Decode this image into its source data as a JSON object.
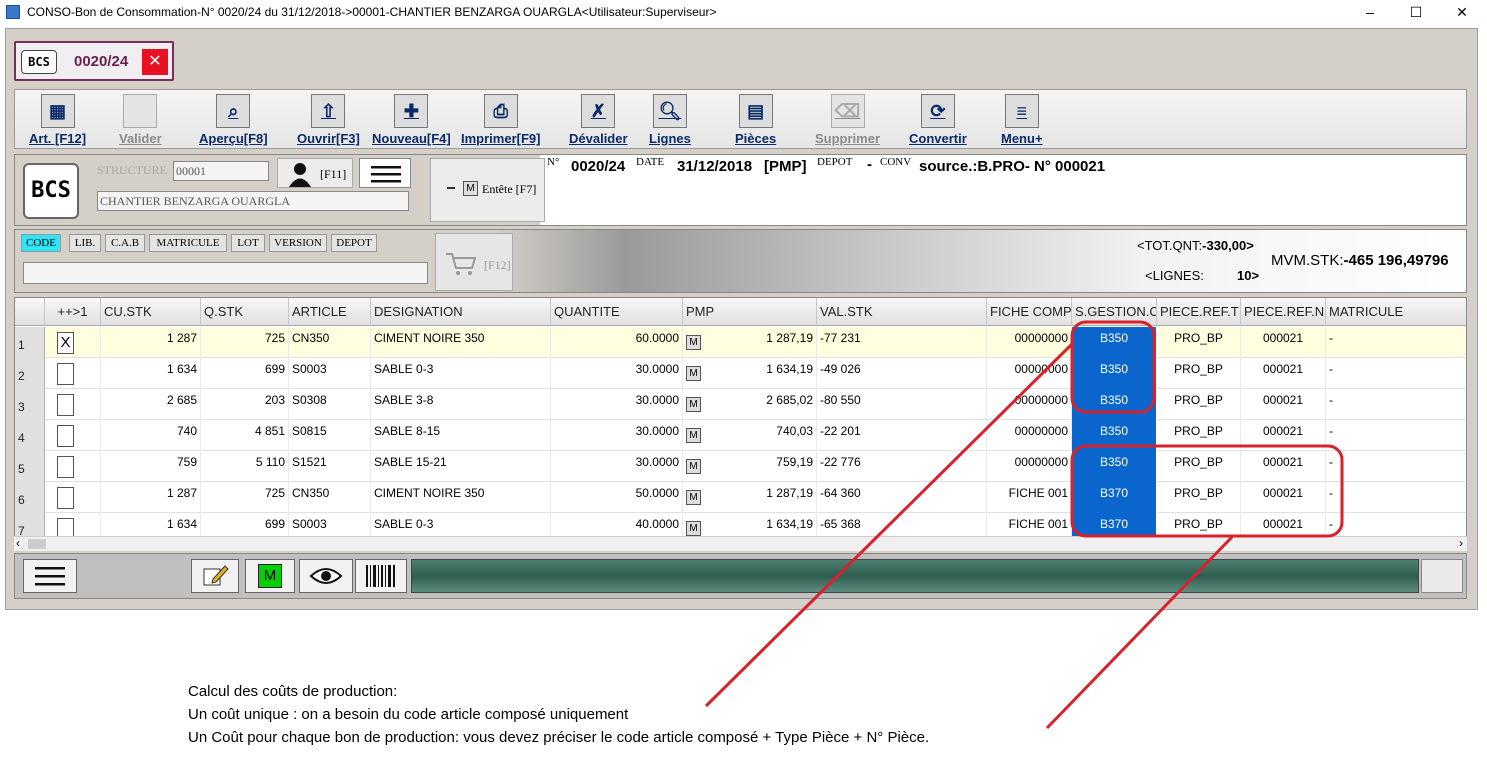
{
  "window": {
    "title": "CONSO-Bon de Consommation-N° 0020/24 du 31/12/2018->00001-CHANTIER BENZARGA OUARGLA<Utilisateur:Superviseur>",
    "min": "–",
    "max": "☐",
    "close": "✕"
  },
  "doctab": {
    "badge": "BCS",
    "number": "0020/24",
    "close": "✕"
  },
  "toolbar": [
    {
      "label": "Art. [F12]",
      "icon": "shelf-icon",
      "disabled": false
    },
    {
      "label": "Valider",
      "icon": "validate-icon",
      "disabled": true
    },
    {
      "label": "Aperçu[F8]",
      "icon": "preview-icon",
      "disabled": false
    },
    {
      "label": "Ouvrir[F3]",
      "icon": "open-icon",
      "disabled": false
    },
    {
      "label": "Nouveau[F4]",
      "icon": "new-icon",
      "disabled": false
    },
    {
      "label": "Imprimer[F9]",
      "icon": "print-icon",
      "disabled": false
    },
    {
      "label": "Dévalider",
      "icon": "unvalidate-icon",
      "disabled": false
    },
    {
      "label": "Lignes",
      "icon": "magnifier-icon",
      "disabled": false
    },
    {
      "label": "Pièces",
      "icon": "grid-icon",
      "disabled": false
    },
    {
      "label": "Supprimer",
      "icon": "delete-icon",
      "disabled": true
    },
    {
      "label": "Convertir",
      "icon": "convert-icon",
      "disabled": false
    },
    {
      "label": "Menu+",
      "icon": "menu-icon",
      "disabled": false
    }
  ],
  "header": {
    "badge": "BCS",
    "structure_label": "STRUCTURE",
    "structure_code": "00001",
    "user_key": "[F11]",
    "structure_name": "CHANTIER BENZARGA OUARGLA",
    "entete_label": "Entête [F7]",
    "n_label": "N°",
    "n_value": "0020/24",
    "date_label": "DATE",
    "date_value": "31/12/2018",
    "pmp": "[PMP]",
    "depot_label": "DEPOT",
    "depot_value": "-",
    "conv_label": "CONV",
    "source": "source.:B.PRO- N° 000021"
  },
  "search": {
    "tabs": [
      "CODE",
      "LIB.",
      "C.A.B",
      "MATRICULE",
      "LOT",
      "VERSION",
      "DEPOT"
    ],
    "active_tab": "CODE",
    "cart_key": "[F12]",
    "tot_qnt_label": "<TOT.QNT:",
    "tot_qnt_value": "-330,00>",
    "lignes_label": "<LIGNES:",
    "lignes_value": "10>",
    "mvm_label": "MVM.STK:",
    "mvm_value": "-465 196,49796"
  },
  "grid": {
    "columns": [
      "",
      "++>1",
      "CU.STK",
      "Q.STK",
      "ARTICLE",
      "DESIGNATION",
      "QUANTITE",
      "PMP",
      "VAL.STK",
      "FICHE COMP",
      "S.GESTION.C",
      "PIECE.REF.T",
      "PIECE.REF.N",
      "MATRICULE"
    ],
    "rows": [
      {
        "n": "1",
        "chk": "X",
        "cu": "1 287",
        "q": "725",
        "art": "CN350",
        "des": "CIMENT NOIRE 350",
        "qte": "60.0000",
        "m": "M",
        "pmp": "1 287,19",
        "val": "-77 231",
        "fiche": "00000000",
        "sg": "B350",
        "prt": "PRO_BP",
        "prn": "000021",
        "mat": "-"
      },
      {
        "n": "2",
        "chk": "",
        "cu": "1 634",
        "q": "699",
        "art": "S0003",
        "des": "SABLE 0-3",
        "qte": "30.0000",
        "m": "M",
        "pmp": "1 634,19",
        "val": "-49 026",
        "fiche": "00000000",
        "sg": "B350",
        "prt": "PRO_BP",
        "prn": "000021",
        "mat": "-"
      },
      {
        "n": "3",
        "chk": "",
        "cu": "2 685",
        "q": "203",
        "art": "S0308",
        "des": "SABLE 3-8",
        "qte": "30.0000",
        "m": "M",
        "pmp": "2 685,02",
        "val": "-80 550",
        "fiche": "00000000",
        "sg": "B350",
        "prt": "PRO_BP",
        "prn": "000021",
        "mat": "-"
      },
      {
        "n": "4",
        "chk": "",
        "cu": "740",
        "q": "4 851",
        "art": "S0815",
        "des": "SABLE 8-15",
        "qte": "30.0000",
        "m": "M",
        "pmp": "740,03",
        "val": "-22 201",
        "fiche": "00000000",
        "sg": "B350",
        "prt": "PRO_BP",
        "prn": "000021",
        "mat": "-"
      },
      {
        "n": "5",
        "chk": "",
        "cu": "759",
        "q": "5 110",
        "art": "S1521",
        "des": "SABLE 15-21",
        "qte": "30.0000",
        "m": "M",
        "pmp": "759,19",
        "val": "-22 776",
        "fiche": "00000000",
        "sg": "B350",
        "prt": "PRO_BP",
        "prn": "000021",
        "mat": "-"
      },
      {
        "n": "6",
        "chk": "",
        "cu": "1 287",
        "q": "725",
        "art": "CN350",
        "des": "CIMENT NOIRE 350",
        "qte": "50.0000",
        "m": "M",
        "pmp": "1 287,19",
        "val": "-64 360",
        "fiche": "FICHE 001",
        "sg": "B370",
        "prt": "PRO_BP",
        "prn": "000021",
        "mat": "-"
      },
      {
        "n": "7",
        "chk": "",
        "cu": "1 634",
        "q": "699",
        "art": "S0003",
        "des": "SABLE 0-3",
        "qte": "40.0000",
        "m": "M",
        "pmp": "1 634,19",
        "val": "-65 368",
        "fiche": "FICHE 001",
        "sg": "B370",
        "prt": "PRO_BP",
        "prn": "000021",
        "mat": "-"
      }
    ]
  },
  "bottombar": {
    "m_label": "M"
  },
  "annotation": {
    "line1": "Calcul des coûts de production:",
    "line2": "Un coût unique : on a besoin du code article composé  uniquement",
    "line3": "Un Coût pour chaque bon de production: vous devez préciser le code article composé + Type Pièce + N° Pièce."
  },
  "colors": {
    "accent_blue": "#0a66cc",
    "annotation_red": "#d9212c",
    "code_tab": "#2ee5f5",
    "close_red": "#e81123"
  }
}
